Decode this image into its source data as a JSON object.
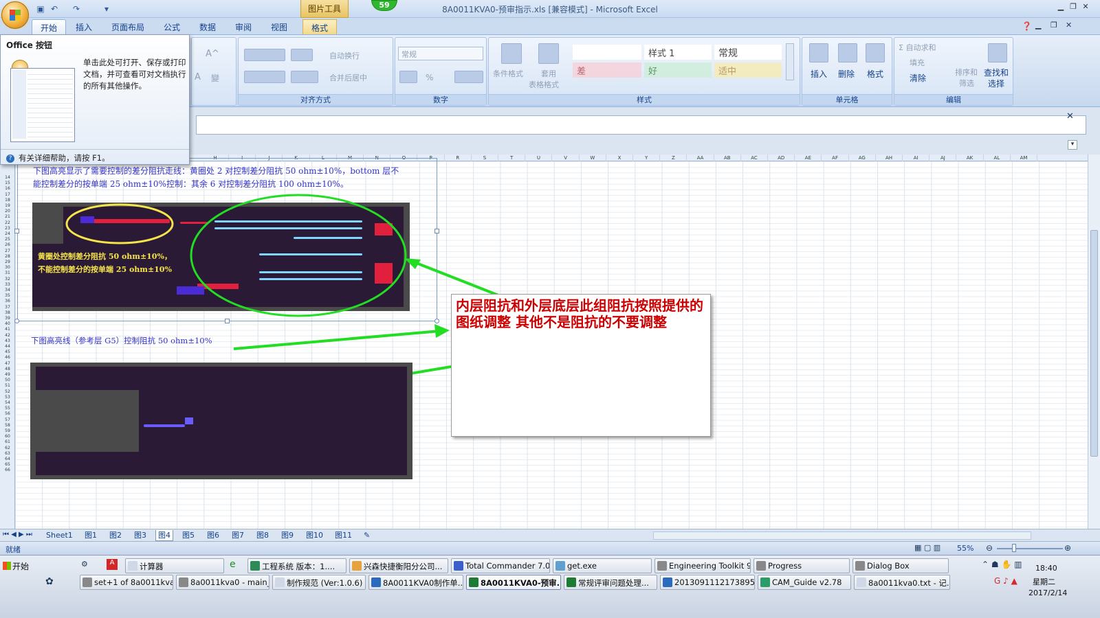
{
  "window": {
    "title": "8A0011KVA0-预审指示.xls  [兼容模式] - Microsoft Excel",
    "context_tab_group": "图片工具",
    "notification_count": "59"
  },
  "tabs": [
    "开始",
    "插入",
    "页面布局",
    "公式",
    "数据",
    "审阅",
    "视图",
    "格式"
  ],
  "ribbon": {
    "alignment": {
      "label": "对齐方式",
      "wrap": "自动换行",
      "merge": "合并后居中"
    },
    "number": {
      "label": "数字",
      "format": "常规",
      "percent": "%"
    },
    "styles": {
      "label": "样式",
      "conditional": "条件格式",
      "table_line1": "套用",
      "table_line2": "表格格式",
      "style1": "样式 1",
      "normal": "常规",
      "bad": "差",
      "good": "好",
      "neutral": "适中"
    },
    "cells": {
      "label": "单元格",
      "insert": "插入",
      "delete": "删除",
      "format": "格式"
    },
    "editing": {
      "label": "编辑",
      "autosum": "Σ 自动求和",
      "fill": "填充",
      "clear": "清除",
      "sort_line1": "排序和",
      "sort_line2": "筛选",
      "find_line1": "查找和",
      "find_line2": "选择"
    }
  },
  "tooltip": {
    "title": "Office 按钮",
    "body": "单击此处可打开、保存或打印文档，并可查看可对文档执行的所有其他操作。",
    "footer": "有关详细帮助，请按 F1。"
  },
  "columns": [
    "H",
    "I",
    "J",
    "K",
    "L",
    "M",
    "N",
    "O",
    "P",
    "R",
    "S",
    "T",
    "U",
    "V",
    "W",
    "X",
    "Y",
    "Z",
    "AA",
    "AB",
    "AC",
    "AD",
    "AE",
    "AF",
    "AG",
    "AH",
    "AI",
    "AJ",
    "AK",
    "AL",
    "AM"
  ],
  "rows": [
    "14",
    "15",
    "16",
    "17",
    "18",
    "19",
    "20",
    "21",
    "22",
    "23",
    "24",
    "25",
    "26",
    "27",
    "28",
    "29",
    "30",
    "31",
    "32",
    "33",
    "34",
    "35",
    "36",
    "37",
    "38",
    "39",
    "40",
    "41",
    "42",
    "43",
    "44",
    "45",
    "46",
    "47",
    "48",
    "49",
    "50",
    "51",
    "52",
    "53",
    "54",
    "55",
    "56",
    "57",
    "58",
    "59",
    "60",
    "61",
    "62",
    "63",
    "64",
    "65",
    "66"
  ],
  "sheet": {
    "note1_line1": "下图高亮显示了需要控制的差分阻抗走线：黄圈处 2 对控制差分阻抗 50 ohm±10%，bottom 层不",
    "note1_line2": "能控制差分的按单端 25 ohm±10%控制：其余 6 对控制差分阻抗 100 ohm±10%。",
    "yellow_note_line1": "黄圈处控制差分阻抗 50 ohm±10%，",
    "yellow_note_line2": "不能控制差分的按单端 25 ohm±10%",
    "note2": "下图高亮线（参考层 G5）控制阻抗 50 ohm±10%",
    "callout": "内层阻抗和外层底层此组阻抗按照提供的图纸调整  其他不是阻抗的不要调整"
  },
  "sheet_tabs": [
    "Sheet1",
    "图1",
    "图2",
    "图3",
    "图4",
    "图5",
    "图6",
    "图7",
    "图8",
    "图9",
    "图10",
    "图11"
  ],
  "active_sheet": "图4",
  "status": {
    "ready": "就绪",
    "zoom": "55%"
  },
  "taskbar": {
    "start": "开始",
    "row1": [
      "计算器",
      "工程系统  版本：1....",
      "兴森快捷衡阳分公司...",
      "Total Commander 7.0 ...",
      "get.exe",
      "Engineering Toolkit 9....",
      "Progress",
      "Dialog Box"
    ],
    "row2": [
      "set+1 of 8a0011kva0",
      "8a0011kva0 - main_qa",
      "制作规范 (Ver:1.0.6)",
      "8A0011KVA0制作单...",
      "8A0011KVA0-预审...",
      "常规评审问题处理...",
      "20130911121738953...",
      "CAM_Guide v2.78",
      "8a0011kva0.txt - 记..."
    ],
    "time": "18:40",
    "weekday": "星期二",
    "date": "2017/2/14"
  },
  "colors": {
    "callout_text": "#cc0000",
    "note_text": "#3333cc",
    "yellow": "#f5e44a",
    "green_arrow": "#22dd22"
  }
}
